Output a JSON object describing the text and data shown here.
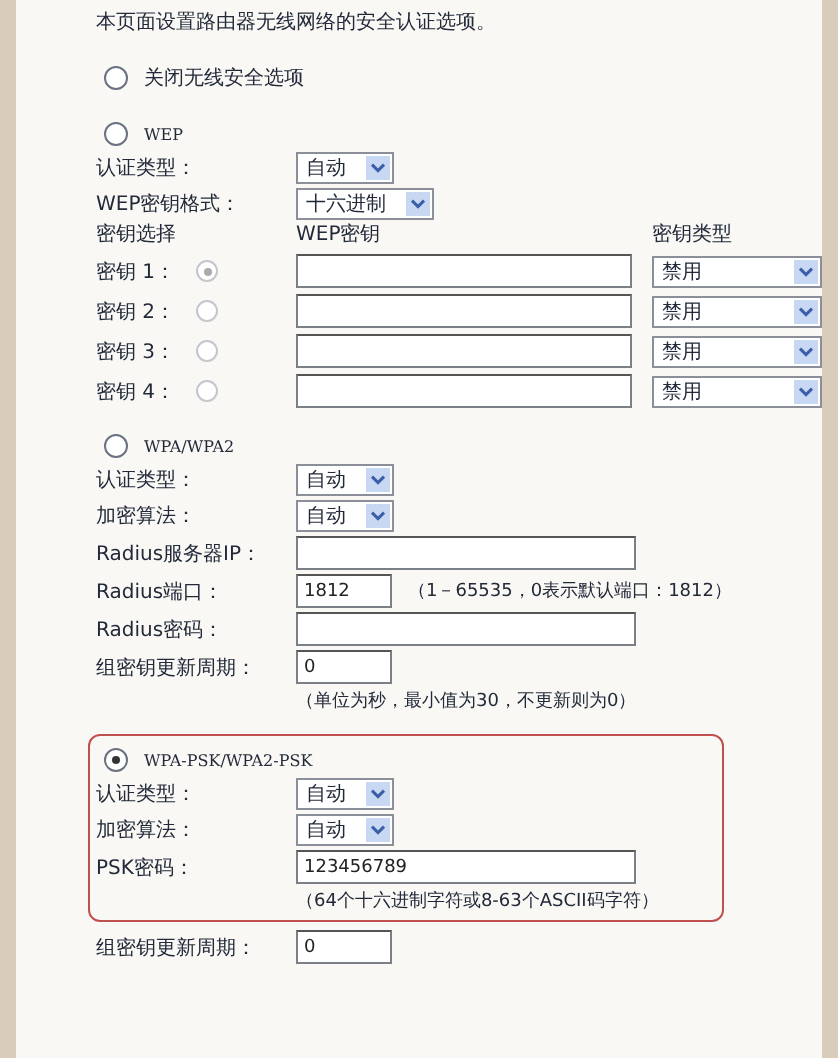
{
  "intro": "本页面设置路由器无线网络的安全认证选项。",
  "modes": [
    {
      "kind": "off",
      "label": "关闭无线安全选项",
      "selected": false,
      "highlighted": false
    },
    {
      "kind": "wep",
      "label": "WEP",
      "selected": false,
      "highlighted": false,
      "fields": [
        {
          "kind": "select",
          "label": "认证类型：",
          "value": "自动"
        },
        {
          "kind": "select",
          "label": "WEP密钥格式：",
          "value": "十六进制"
        }
      ],
      "key_table": {
        "columns": [
          "密钥选择",
          "WEP密钥",
          "密钥类型"
        ],
        "keys": [
          {
            "label": "密钥 1：",
            "selected": true,
            "type": "禁用"
          },
          {
            "label": "密钥 2：",
            "selected": false,
            "type": "禁用"
          },
          {
            "label": "密钥 3：",
            "selected": false,
            "type": "禁用"
          },
          {
            "label": "密钥 4：",
            "selected": false,
            "type": "禁用"
          }
        ]
      }
    },
    {
      "kind": "wpa",
      "label": "WPA/WPA2",
      "selected": false,
      "highlighted": false,
      "fields": [
        {
          "kind": "select",
          "label": "认证类型：",
          "value": "自动"
        },
        {
          "kind": "select",
          "label": "加密算法：",
          "value": "自动"
        },
        {
          "kind": "text",
          "label": "Radius服务器IP："
        },
        {
          "kind": "number",
          "label": "Radius端口：",
          "value": "1812",
          "note": "（1－65535，0表示默认端口：1812）"
        },
        {
          "kind": "text",
          "label": "Radius密码："
        },
        {
          "kind": "number",
          "label": "组密钥更新周期：",
          "value": "0"
        },
        {
          "kind": "hint",
          "text": "（单位为秒，最小值为30，不更新则为0）"
        }
      ]
    },
    {
      "kind": "psk",
      "label": "WPA-PSK/WPA2-PSK",
      "selected": true,
      "highlighted": true,
      "fields": [
        {
          "kind": "select",
          "label": "认证类型：",
          "value": "自动"
        },
        {
          "kind": "select",
          "label": "加密算法：",
          "value": "自动"
        },
        {
          "kind": "text",
          "label": "PSK密码：",
          "value": "123456789"
        },
        {
          "kind": "hint",
          "text": "（64个十六进制字符或8-63个ASCII码字符）"
        }
      ],
      "trailing_fields": [
        {
          "kind": "number",
          "label": "组密钥更新周期：",
          "value": "0"
        }
      ]
    }
  ]
}
